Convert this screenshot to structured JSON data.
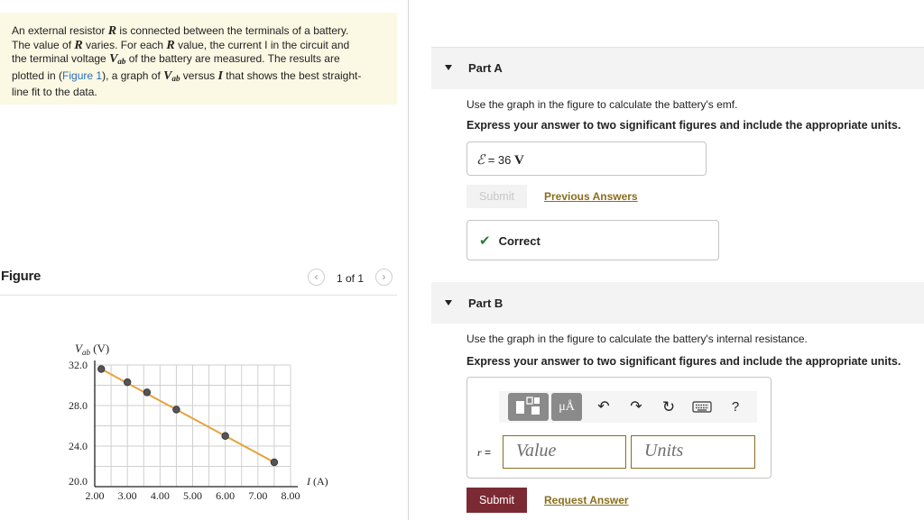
{
  "problem": {
    "line1_a": "An external resistor ",
    "var_R": "R",
    "line1_b": " is connected between the terminals of a battery.",
    "line2_a": "The value of ",
    "line2_b": " varies. For each ",
    "line2_c": " value, the current I in the circuit and",
    "line3_a": "the terminal voltage ",
    "var_V": "V",
    "sub_ab": "ab",
    "line3_b": " of the battery are measured. The results are",
    "line4_a": "plotted in (",
    "figure_link": "Figure 1",
    "line4_b": "), a graph of ",
    "line4_c": " versus ",
    "var_I": "I",
    "line4_d": " that shows the best straight-",
    "line5": "line fit to the data."
  },
  "figure": {
    "heading": "Figure",
    "counter": "1 of 1",
    "prev_icon": "chevron-left",
    "next_icon": "chevron-right"
  },
  "chart_data": {
    "type": "scatter",
    "ylabel": "V",
    "ylabel_sub": "ab",
    "ylabel_unit": " (V)",
    "xlabel": "I (A)",
    "x_ticks": [
      "2.00",
      "3.00",
      "4.00",
      "5.00",
      "6.00",
      "7.00",
      "8.00"
    ],
    "y_ticks": [
      "32.0",
      "28.0",
      "24.0",
      "20.0"
    ],
    "xlim": [
      2,
      8
    ],
    "ylim": [
      20,
      32
    ],
    "grid": true,
    "x": [
      2.2,
      3.0,
      3.6,
      4.5,
      6.0,
      7.5
    ],
    "y": [
      31.6,
      30.3,
      29.3,
      27.6,
      25.0,
      22.4
    ],
    "fit_line": [
      [
        2.2,
        31.6
      ],
      [
        7.5,
        22.4
      ]
    ],
    "fit_color": "#e8a23a",
    "point_color": "#555555"
  },
  "partA": {
    "title": "Part A",
    "instruction": "Use the graph in the figure to calculate the battery's emf.",
    "express": "Express your answer to two significant figures and include the appropriate units.",
    "answer_symbol": "ℰ",
    "answer_eq": " = ",
    "answer_value": "36",
    "answer_unit": "V",
    "submit_label": "Submit",
    "previous_answers_label": "Previous Answers",
    "correct_label": "Correct",
    "correct_icon": "check-icon",
    "correct_color": "#2e7d32"
  },
  "partB": {
    "title": "Part B",
    "instruction": "Use the graph in the figure to calculate the battery's internal resistance.",
    "express": "Express your answer to two significant figures and include the appropriate units.",
    "var_label": "r",
    "eq_label": " =",
    "value_placeholder": "Value",
    "units_placeholder": "Units",
    "units_button_label": "μÅ",
    "help_label": "?",
    "submit_label": "Submit",
    "request_answer_label": "Request Answer",
    "submit_color": "#7b2a33"
  }
}
